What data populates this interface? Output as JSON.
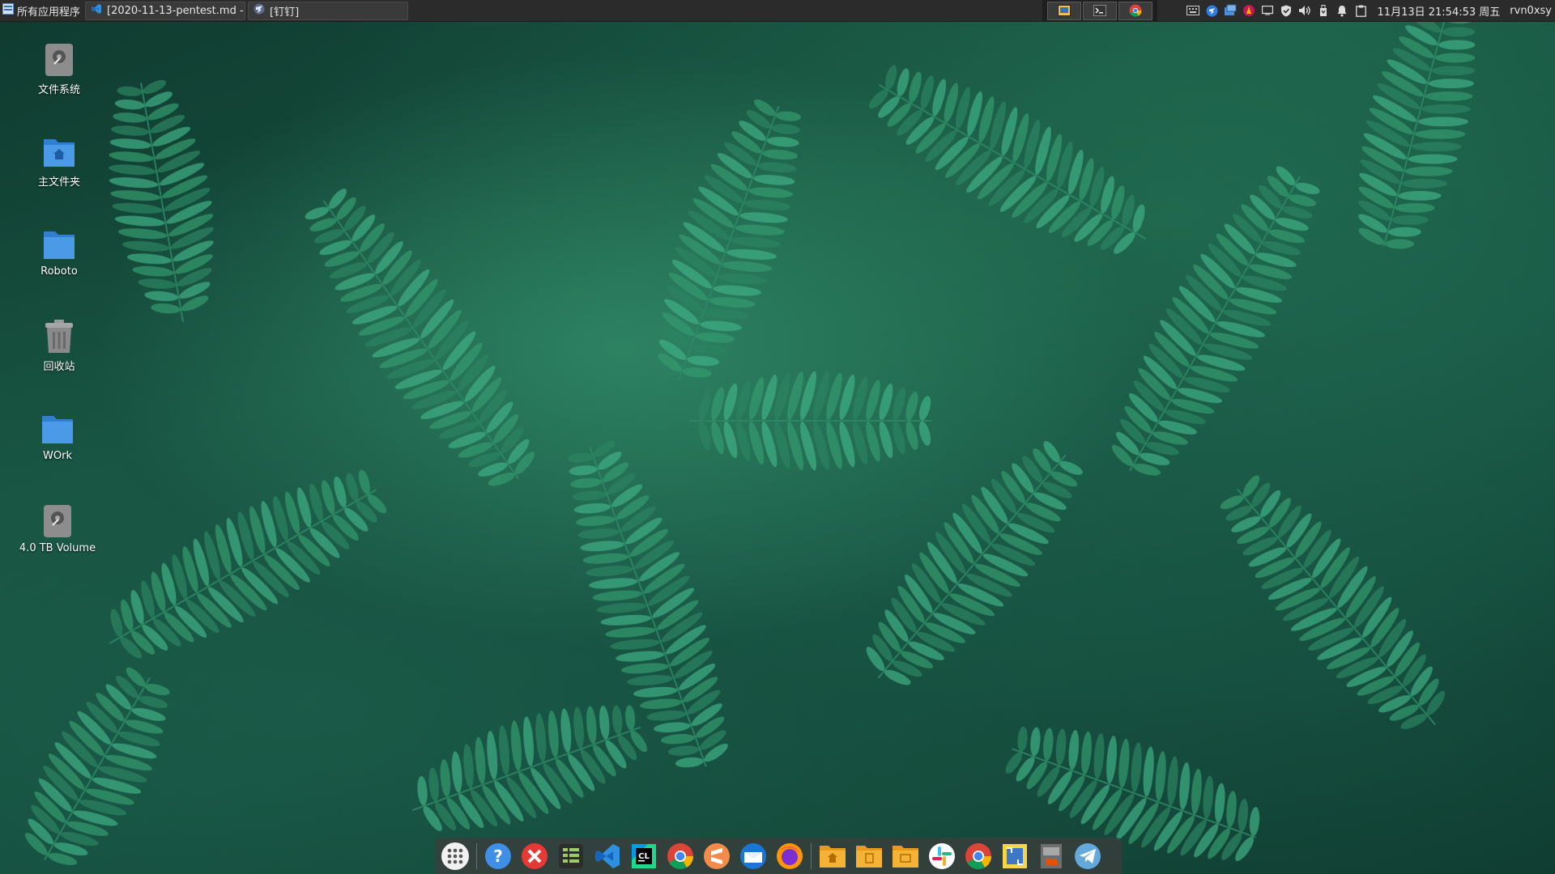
{
  "panel": {
    "app_menu_label": "所有应用程序",
    "tasks": [
      {
        "label": "[2020-11-13-pentest.md - ···",
        "icon": "vscode-icon"
      },
      {
        "label": "[钉钉]",
        "icon": "dingtalk-icon"
      }
    ],
    "launchers": [
      "window-switcher-icon",
      "terminal-icon",
      "chrome-icon"
    ],
    "tray_icons": [
      "keyboard-icon",
      "dingtalk-tray-icon",
      "screenshot-icon",
      "app-tray-icon",
      "screen-icon",
      "shield-icon",
      "volume-icon",
      "usb-icon",
      "notification-bell-icon",
      "clipboard-icon"
    ],
    "clock": "11月13日 21:54:53 周五",
    "username": "rvn0xsy"
  },
  "desktop": {
    "icons": [
      {
        "label": "文件系统",
        "icon": "drive-icon"
      },
      {
        "label": "主文件夹",
        "icon": "home-folder-icon"
      },
      {
        "label": "Roboto",
        "icon": "folder-icon"
      },
      {
        "label": "回收站",
        "icon": "trash-icon"
      },
      {
        "label": "WOrk",
        "icon": "folder-icon"
      },
      {
        "label": "4.0 TB Volume",
        "icon": "drive-icon"
      }
    ]
  },
  "dock": {
    "items": [
      "app-grid-icon",
      "help-icon",
      "xmind-icon",
      "system-monitor-icon",
      "vscode-icon",
      "clion-icon",
      "chrome-icon",
      "sublime-icon",
      "mail-icon",
      "firefox-icon",
      "home-folder-icon",
      "documents-folder-icon",
      "folder-icon",
      "slack-icon",
      "chrome-icon",
      "shutter-icon",
      "burp-icon",
      "telegram-icon"
    ]
  },
  "colors": {
    "panel_bg": "#2b2b2b",
    "folder_blue": "#3b8fe0",
    "wallpaper_green": "#1f7a5c"
  }
}
